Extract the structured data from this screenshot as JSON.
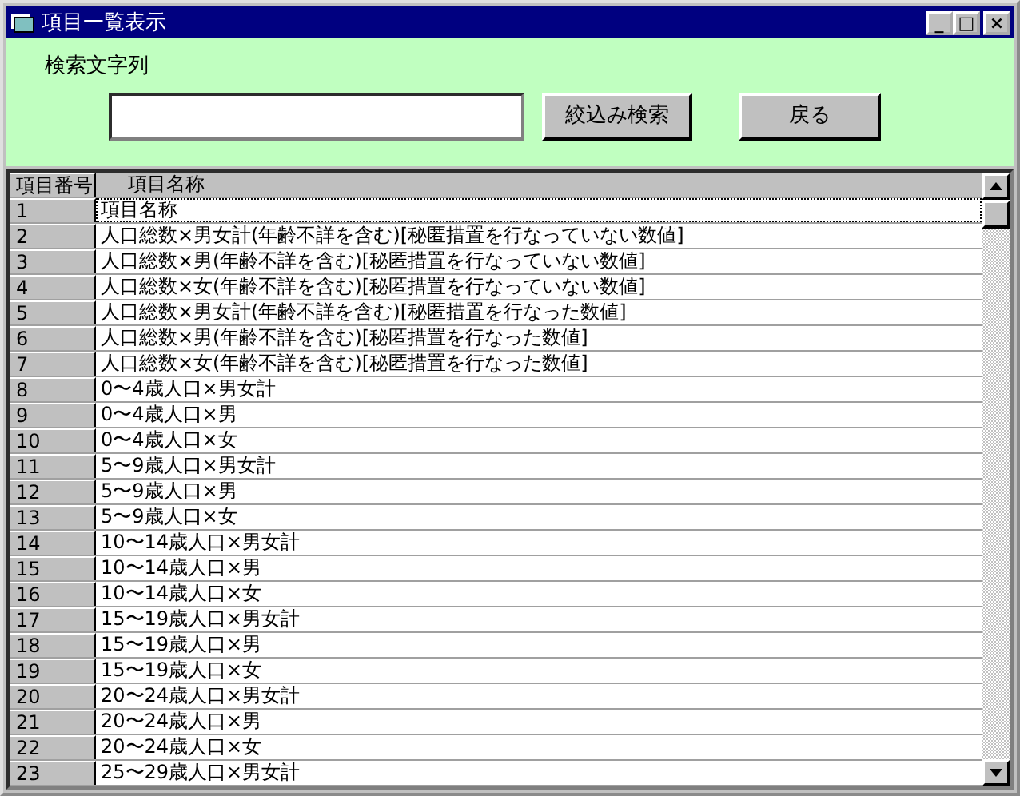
{
  "window": {
    "title": "項目一覧表示",
    "controls": [
      "_",
      "□",
      "×"
    ]
  },
  "search": {
    "label": "検索文字列"
  },
  "buttons": [
    "絞込み検索",
    "戻る"
  ],
  "table": {
    "columns": [
      "項目番号",
      "項目名称"
    ],
    "rows": [
      {
        "number": "1",
        "name": "項目名称",
        "focused": true
      },
      {
        "number": "2",
        "name": "人口総数×男女計(年齢不詳を含む)[秘匿措置を行なっていない数値]",
        "focused": false
      },
      {
        "number": "3",
        "name": "人口総数×男(年齢不詳を含む)[秘匿措置を行なっていない数値]",
        "focused": false
      },
      {
        "number": "4",
        "name": "人口総数×女(年齢不詳を含む)[秘匿措置を行なっていない数値]",
        "focused": false
      },
      {
        "number": "5",
        "name": "人口総数×男女計(年齢不詳を含む)[秘匿措置を行なった数値]",
        "focused": false
      },
      {
        "number": "6",
        "name": "人口総数×男(年齢不詳を含む)[秘匿措置を行なった数値]",
        "focused": false
      },
      {
        "number": "7",
        "name": "人口総数×女(年齢不詳を含む)[秘匿措置を行なった数値]",
        "focused": false
      },
      {
        "number": "8",
        "name": "0〜4歳人口×男女計",
        "focused": false
      },
      {
        "number": "9",
        "name": "0〜4歳人口×男",
        "focused": false
      },
      {
        "number": "10",
        "name": "0〜4歳人口×女",
        "focused": false
      },
      {
        "number": "11",
        "name": "5〜9歳人口×男女計",
        "focused": false
      },
      {
        "number": "12",
        "name": "5〜9歳人口×男",
        "focused": false
      },
      {
        "number": "13",
        "name": "5〜9歳人口×女",
        "focused": false
      },
      {
        "number": "14",
        "name": "10〜14歳人口×男女計",
        "focused": false
      },
      {
        "number": "15",
        "name": "10〜14歳人口×男",
        "focused": false
      },
      {
        "number": "16",
        "name": "10〜14歳人口×女",
        "focused": false
      },
      {
        "number": "17",
        "name": "15〜19歳人口×男女計",
        "focused": false
      },
      {
        "number": "18",
        "name": "15〜19歳人口×男",
        "focused": false
      },
      {
        "number": "19",
        "name": "15〜19歳人口×女",
        "focused": false
      },
      {
        "number": "20",
        "name": "20〜24歳人口×男女計",
        "focused": false
      },
      {
        "number": "21",
        "name": "20〜24歳人口×男",
        "focused": false
      },
      {
        "number": "22",
        "name": "20〜24歳人口×女",
        "focused": false
      },
      {
        "number": "23",
        "name": "25〜29歳人口×男女計",
        "focused": false
      }
    ]
  }
}
